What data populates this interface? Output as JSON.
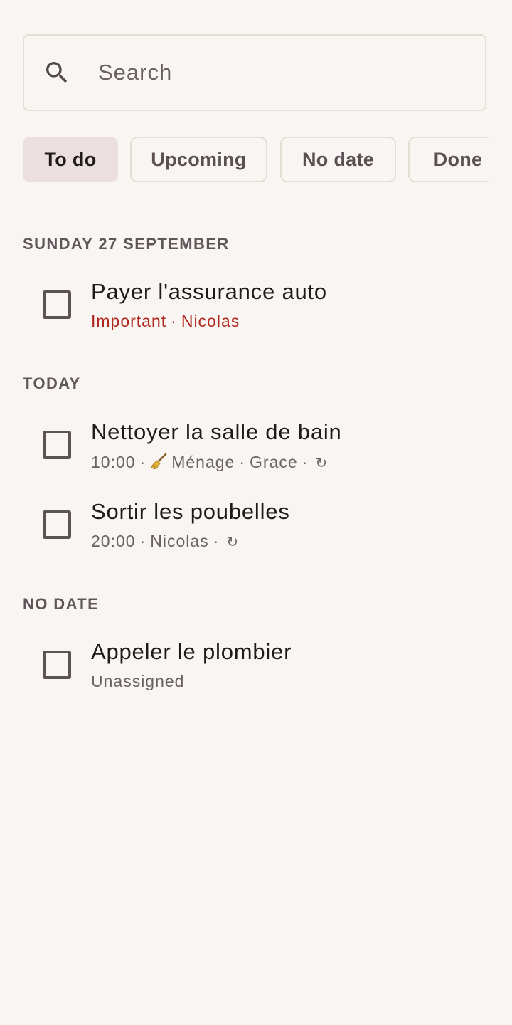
{
  "search": {
    "placeholder": "Search",
    "icon": "search-icon"
  },
  "filters": [
    {
      "label": "To do",
      "selected": true
    },
    {
      "label": "Upcoming",
      "selected": false
    },
    {
      "label": "No date",
      "selected": false
    },
    {
      "label": "Done",
      "selected": false
    }
  ],
  "sections": [
    {
      "header": "SUNDAY 27 SEPTEMBER",
      "tasks": [
        {
          "title": "Payer l'assurance auto",
          "meta": [
            "Important",
            "Nicolas"
          ],
          "important": true,
          "recurring": false
        }
      ]
    },
    {
      "header": "TODAY",
      "tasks": [
        {
          "title": "Nettoyer la salle de bain",
          "time": "10:00",
          "category_icon": "broom-icon",
          "category": "Ménage",
          "assignee": "Grace",
          "recurring": true
        },
        {
          "title": "Sortir les poubelles",
          "time": "20:00",
          "assignee": "Nicolas",
          "recurring": true
        }
      ]
    },
    {
      "header": "NO DATE",
      "tasks": [
        {
          "title": "Appeler le plombier",
          "meta": [
            "Unassigned"
          ],
          "recurring": false
        }
      ]
    }
  ],
  "symbols": {
    "separator": "·",
    "recurring": "↻"
  },
  "colors": {
    "background": "#f9f5f2",
    "important": "#b3261e",
    "chip_selected": "#ebdfe0",
    "outline": "#e6ddd3"
  }
}
